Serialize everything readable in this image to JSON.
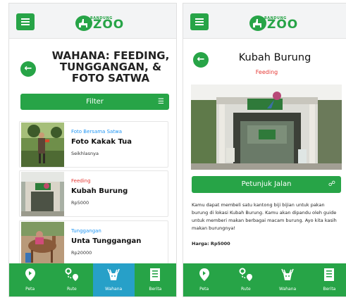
{
  "brand": {
    "top_text": "BANDUNG",
    "main_text": "ZOO",
    "color": "#27A447"
  },
  "left": {
    "title": "WAHANA: FEEDING, TUNGGANGAN, & FOTO SATWA",
    "back_icon": "arrow-left",
    "filter": {
      "label": "Filter",
      "icon": "filter-list-icon"
    },
    "items": [
      {
        "category": "Foto Bersama Satwa",
        "category_color": "#2196F3",
        "name": "Foto Kakak Tua",
        "price": "Seikhlasnya"
      },
      {
        "category": "Feeding",
        "category_color": "#E53935",
        "name": "Kubah Burung",
        "price": "Rp5000"
      },
      {
        "category": "Tunggangan",
        "category_color": "#2196F3",
        "name": "Unta Tunggangan",
        "price": "Rp20000"
      }
    ]
  },
  "right": {
    "title": "Kubah Burung",
    "category": "Feeding",
    "category_color": "#E53935",
    "directions_label": "Petunjuk Jalan",
    "description": "Kamu dapat membeli satu kantong biji bijian untuk pakan burung di lokasi Kubah Burung. Kamu akan dipandu oleh guide untuk memberi makan berbagai macam burung. Ayo kita kasih makan burungnya!",
    "price_text": "Harga: Rp5000"
  },
  "nav": {
    "items": [
      {
        "label": "Peta",
        "icon": "map-pin-icon"
      },
      {
        "label": "Rute",
        "icon": "route-icon"
      },
      {
        "label": "Wahana",
        "icon": "animal-head-icon"
      },
      {
        "label": "Berita",
        "icon": "news-icon"
      }
    ],
    "active_left": "Wahana",
    "active_color": "#27A0C8"
  }
}
